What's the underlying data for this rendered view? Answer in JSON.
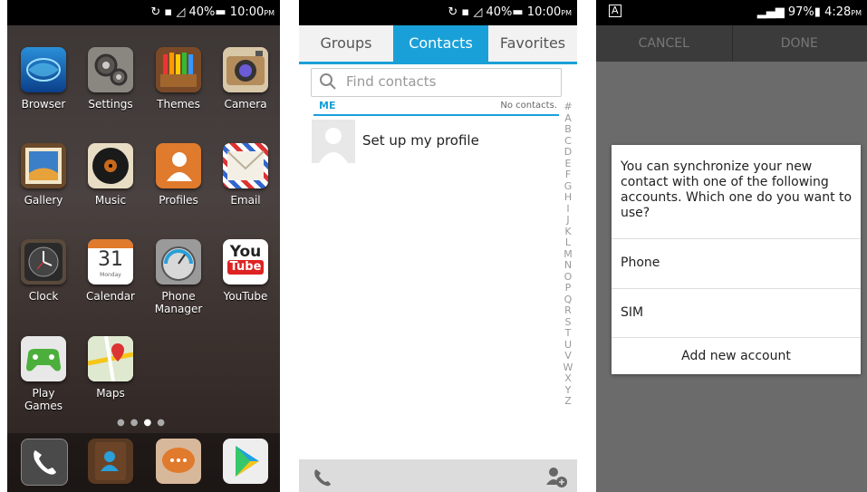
{
  "screen1": {
    "status": {
      "time": "10:00",
      "ampm": "PM",
      "battery": "40%"
    },
    "apps": [
      {
        "label": "Browser",
        "icon": "browser-icon"
      },
      {
        "label": "Settings",
        "icon": "settings-icon"
      },
      {
        "label": "Themes",
        "icon": "themes-icon"
      },
      {
        "label": "Camera",
        "icon": "camera-icon"
      },
      {
        "label": "Gallery",
        "icon": "gallery-icon"
      },
      {
        "label": "Music",
        "icon": "music-icon"
      },
      {
        "label": "Profiles",
        "icon": "profiles-icon"
      },
      {
        "label": "Email",
        "icon": "email-icon"
      },
      {
        "label": "Clock",
        "icon": "clock-icon"
      },
      {
        "label": "Calendar",
        "icon": "calendar-icon",
        "day": "31",
        "weekday": "Monday"
      },
      {
        "label": "Phone Manager",
        "icon": "phone-manager-icon"
      },
      {
        "label": "YouTube",
        "icon": "youtube-icon",
        "logo_top": "You",
        "logo_bottom": "Tube"
      },
      {
        "label": "Play Games",
        "icon": "play-games-icon"
      },
      {
        "label": "Maps",
        "icon": "maps-icon"
      }
    ],
    "dock": [
      "phone-icon",
      "contacts-icon",
      "messaging-icon",
      "play-store-icon"
    ]
  },
  "screen2": {
    "status": {
      "time": "10:00",
      "ampm": "PM",
      "battery": "40%"
    },
    "tabs": [
      {
        "label": "Groups",
        "active": false
      },
      {
        "label": "Contacts",
        "active": true
      },
      {
        "label": "Favorites",
        "active": false
      }
    ],
    "search_placeholder": "Find contacts",
    "section_label": "ME",
    "no_contacts": "No contacts.",
    "profile_label": "Set up my profile",
    "alphabet": [
      "#",
      "A",
      "B",
      "C",
      "D",
      "E",
      "F",
      "G",
      "H",
      "I",
      "J",
      "K",
      "L",
      "M",
      "N",
      "O",
      "P",
      "Q",
      "R",
      "S",
      "T",
      "U",
      "V",
      "W",
      "X",
      "Y",
      "Z"
    ],
    "accent": "#1aa0d8"
  },
  "screen3": {
    "status": {
      "time": "4:28",
      "ampm": "PM",
      "battery": "97%"
    },
    "cancel_label": "CANCEL",
    "done_label": "DONE",
    "dialog": {
      "message": "You can synchronize your new contact with one of the following accounts. Which one do you want to use?",
      "options": [
        "Phone",
        "SIM"
      ],
      "add_label": "Add new account"
    }
  }
}
